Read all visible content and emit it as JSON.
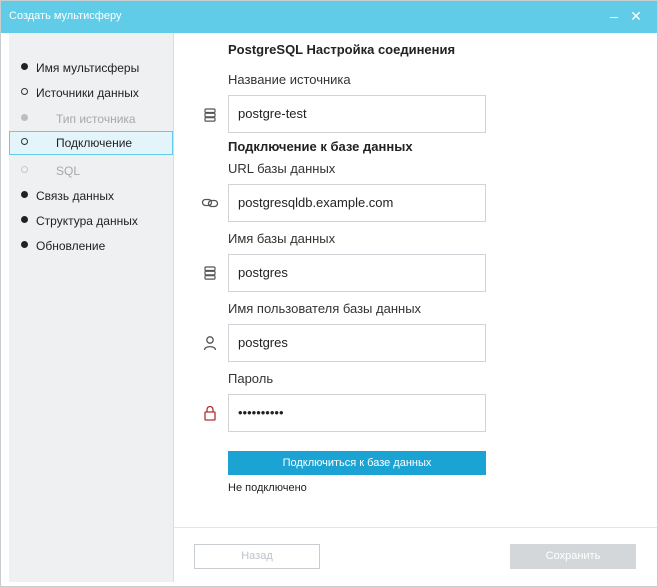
{
  "window": {
    "title": "Создать мультисферу",
    "minimize_glyph": "–",
    "close_glyph": "✕"
  },
  "sidebar": {
    "items": [
      {
        "label": "Имя мультисферы",
        "state": "done"
      },
      {
        "label": "Источники данных",
        "state": "current-parent"
      },
      {
        "label": "Тип источника",
        "state": "disabled"
      },
      {
        "label": "Подключение",
        "state": "active"
      },
      {
        "label": "SQL",
        "state": "disabled"
      },
      {
        "label": "Связь данных",
        "state": "done"
      },
      {
        "label": "Структура данных",
        "state": "done"
      },
      {
        "label": "Обновление",
        "state": "done"
      }
    ]
  },
  "form": {
    "title": "PostgreSQL Настройка соединения",
    "source_name_label": "Название источника",
    "source_name_value": "postgre-test",
    "db_section_title": "Подключение к базе данных",
    "db_url_label": "URL базы данных",
    "db_url_value": "postgresqldb.example.com",
    "db_name_label": "Имя базы данных",
    "db_name_value": "postgres",
    "db_user_label": "Имя пользователя базы данных",
    "db_user_value": "postgres",
    "password_label": "Пароль",
    "password_value": "••••••••••",
    "connect_button": "Подключиться к базе данных",
    "status_text": "Не подключено"
  },
  "footer": {
    "back_button": "Назад",
    "save_button": "Сохранить"
  },
  "icons": {
    "source": "database-icon",
    "url": "link-icon",
    "db_name": "database-icon",
    "user": "user-icon",
    "password": "lock-icon"
  },
  "colors": {
    "titlebar": "#61cce8",
    "accent": "#1ba3d4",
    "sidebar_bg": "#eef0f2",
    "active_item_bg": "#e3f5fb"
  }
}
